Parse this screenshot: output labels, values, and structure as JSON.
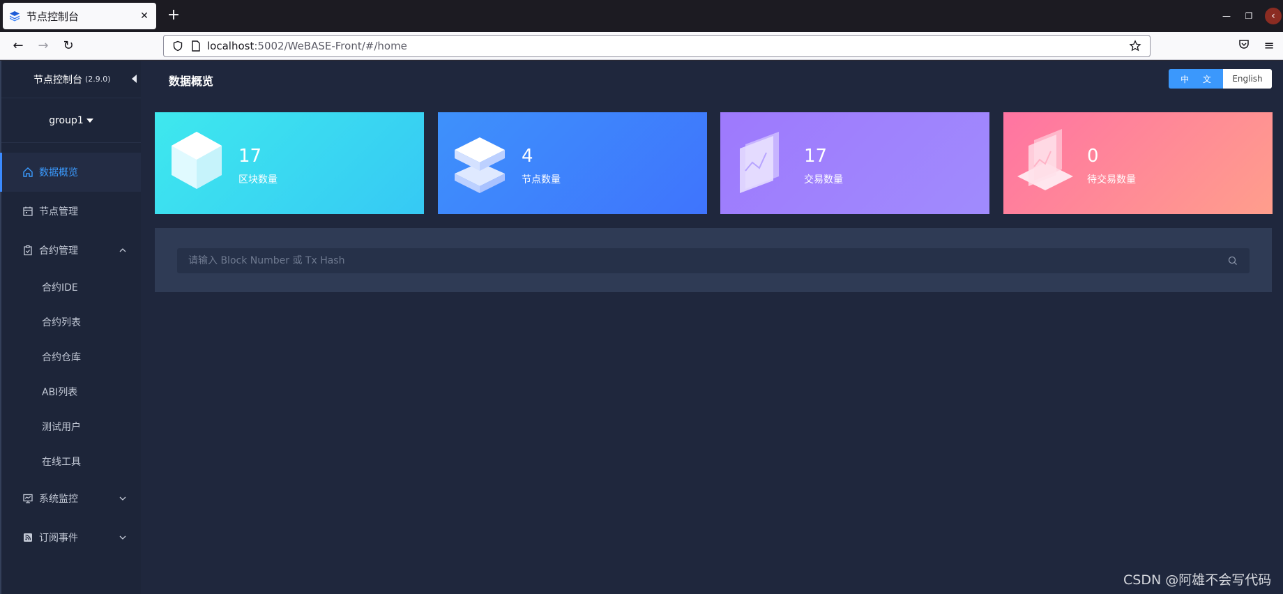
{
  "browser": {
    "tab_title": "节点控制台",
    "url_host": "localhost",
    "url_rest": ":5002/WeBASE-Front/#/home"
  },
  "sidebar": {
    "brand": "节点控制台",
    "version": "(2.9.0)",
    "group": "group1",
    "items": [
      {
        "label": "数据概览"
      },
      {
        "label": "节点管理"
      },
      {
        "label": "合约管理"
      },
      {
        "label": "系统监控"
      },
      {
        "label": "订阅事件"
      }
    ],
    "sub_items": [
      {
        "label": "合约IDE"
      },
      {
        "label": "合约列表"
      },
      {
        "label": "合约仓库"
      },
      {
        "label": "ABI列表"
      },
      {
        "label": "测试用户"
      },
      {
        "label": "在线工具"
      }
    ]
  },
  "main": {
    "title": "数据概览",
    "lang_zh": "中 文",
    "lang_en": "English",
    "cards": [
      {
        "value": "17",
        "label": "区块数量"
      },
      {
        "value": "4",
        "label": "节点数量"
      },
      {
        "value": "17",
        "label": "交易数量"
      },
      {
        "value": "0",
        "label": "待交易数量"
      }
    ],
    "search_placeholder": "请输入 Block Number 或 Tx Hash"
  },
  "watermark": "CSDN @阿雄不会写代码",
  "colors": {
    "accent": "#3b98fc",
    "bg": "#1f273d",
    "sidebar": "#1d2539",
    "card1": "#3ee8ee",
    "card2": "#3e91fb",
    "card3": "#9e79fd",
    "card4": "#ff74a2"
  }
}
